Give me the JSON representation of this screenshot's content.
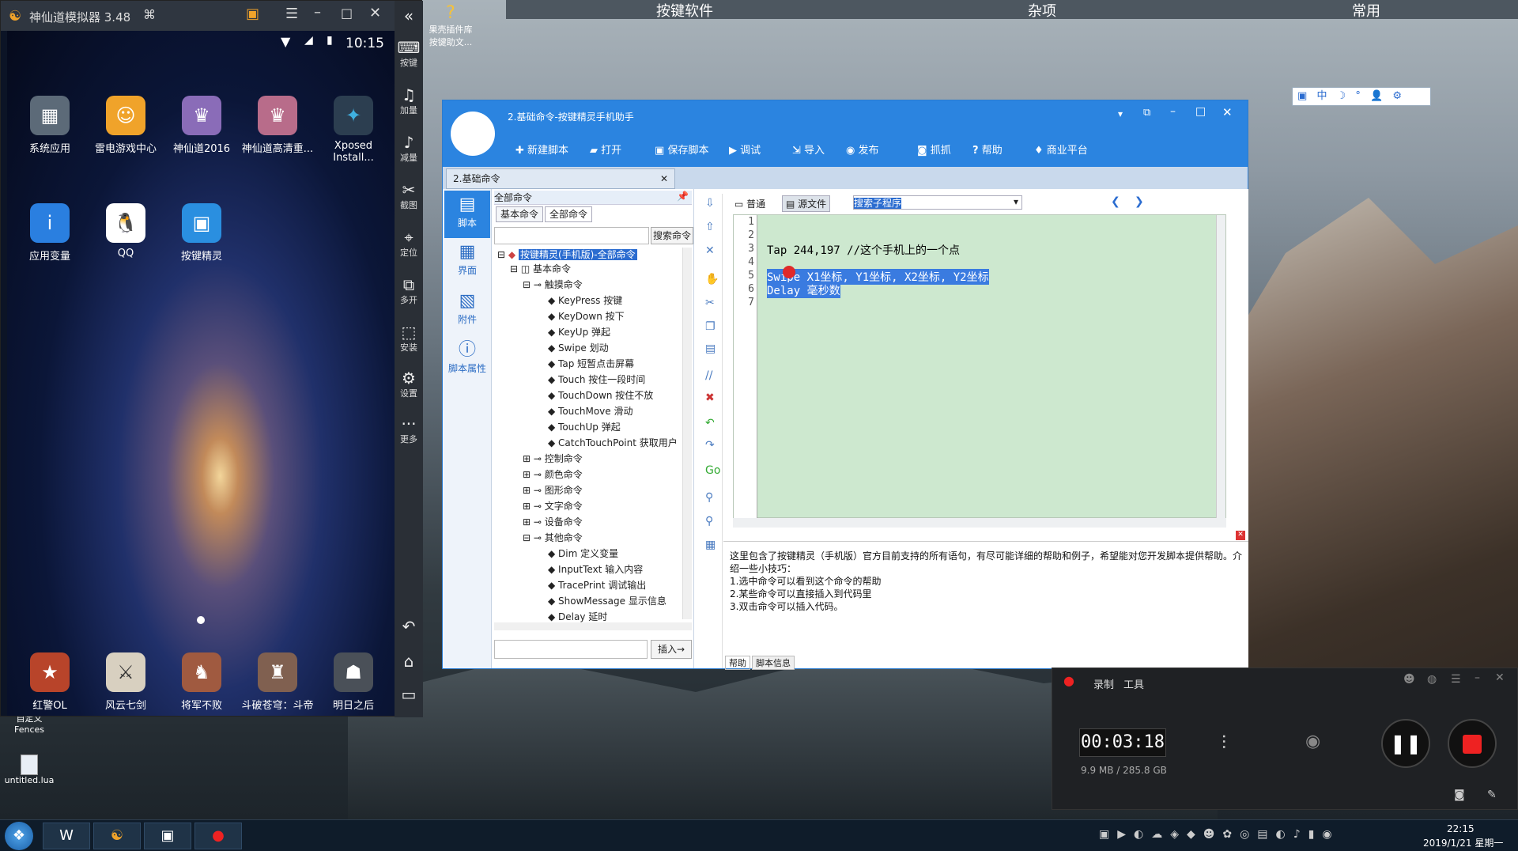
{
  "topbar": {
    "items": [
      "按键软件",
      "杂项",
      "常用"
    ]
  },
  "emulator": {
    "title": "神仙道模拟器 3.48",
    "time": "10:15",
    "apps_row1": [
      {
        "label": "系统应用",
        "icon": "folder-icon",
        "color": "#6b7a8a"
      },
      {
        "label": "雷电游戏中心",
        "icon": "game-center-icon",
        "color": "#f0a32a"
      },
      {
        "label": "神仙道2016",
        "icon": "game-icon",
        "color": "#8a6cb8"
      },
      {
        "label": "神仙道高清重...",
        "icon": "game-icon",
        "color": "#b86c8a"
      },
      {
        "label": "Xposed Install...",
        "icon": "xposed-icon",
        "color": "#2c3e50"
      }
    ],
    "apps_row2": [
      {
        "label": "应用变量",
        "icon": "info-icon",
        "color": "#2a7fe0"
      },
      {
        "label": "QQ",
        "icon": "qq-icon",
        "color": "#ffffff"
      },
      {
        "label": "按键精灵",
        "icon": "robot-icon",
        "color": "#2a8fe0"
      }
    ],
    "dock": [
      "红警OL",
      "风云七剑",
      "将军不败",
      "斗破苍穹：斗帝",
      "明日之后"
    ],
    "side": [
      "按键",
      "加量",
      "减量",
      "截图",
      "定位",
      "多开",
      "安装",
      "设置",
      "更多"
    ]
  },
  "desktop": {
    "icon_top": "果壳插件库\n按键助文...",
    "icon_fences": "自定义\nFences",
    "icon_lua": "untitled.lua"
  },
  "window": {
    "title": "2.基础命令-按键精灵手机助手",
    "toolbar": [
      "新建脚本",
      "打开",
      "保存脚本",
      "调试",
      "导入",
      "发布",
      "抓抓",
      "帮助",
      "商业平台"
    ],
    "tab": "2.基础命令",
    "left_nav": [
      "脚本",
      "界面",
      "附件",
      "脚本属性"
    ],
    "tree_header": "全部命令",
    "tree_tabs": [
      "基本命令",
      "全部命令"
    ],
    "search_btn": "搜索命令",
    "tree_root": "按键精灵(手机版)-全部命令",
    "tree_basic": "基本命令",
    "tree_touch": "触摸命令",
    "touch_items": [
      "KeyPress 按键",
      "KeyDown 按下",
      "KeyUp 弹起",
      "Swipe 划动",
      "Tap 短暂点击屏幕",
      "Touch 按住一段时间",
      "TouchDown 按住不放",
      "TouchMove 滑动",
      "TouchUp 弹起",
      "CatchTouchPoint 获取用户"
    ],
    "groups": [
      "控制命令",
      "颜色命令",
      "图形命令",
      "文字命令",
      "设备命令",
      "其他命令"
    ],
    "other_items": [
      "Dim 定义变量",
      "InputText 输入内容",
      "TracePrint 调试输出",
      "ShowMessage 显示信息",
      "Delay 延时"
    ],
    "insert_btn": "插入→",
    "editor_tabs": [
      "普通",
      "源文件"
    ],
    "search_sub": "搜索子程序",
    "line_numbers": [
      "1",
      "2",
      "3",
      "4",
      "5",
      "6",
      "7"
    ],
    "code_line3": "Tap 244,197 //这个手机上的一个点",
    "code_line5": "Swipe X1坐标, Y1坐标, X2坐标, Y2坐标",
    "code_line6": "Delay 毫秒数",
    "help_text": [
      "这里包含了按键精灵（手机版）官方目前支持的所有语句，有尽可能详细的帮助和例子，希望能对您开发脚本提供帮助。介绍一些小技巧：",
      "1.选中命令可以看到这个命令的帮助",
      "2.某些命令可以直接插入到代码里",
      "3.双击命令可以插入代码。"
    ],
    "bottom_tabs": [
      "帮助",
      "脚本信息"
    ]
  },
  "ime": [
    "中",
    "☽",
    "°",
    "👤",
    "⚙"
  ],
  "recorder": {
    "tabs": [
      "录制",
      "工具"
    ],
    "timer": "00:03:18",
    "storage": "9.9 MB / 285.8 GB"
  },
  "taskbar": {
    "time": "22:15",
    "date": "2019/1/21 星期一"
  }
}
